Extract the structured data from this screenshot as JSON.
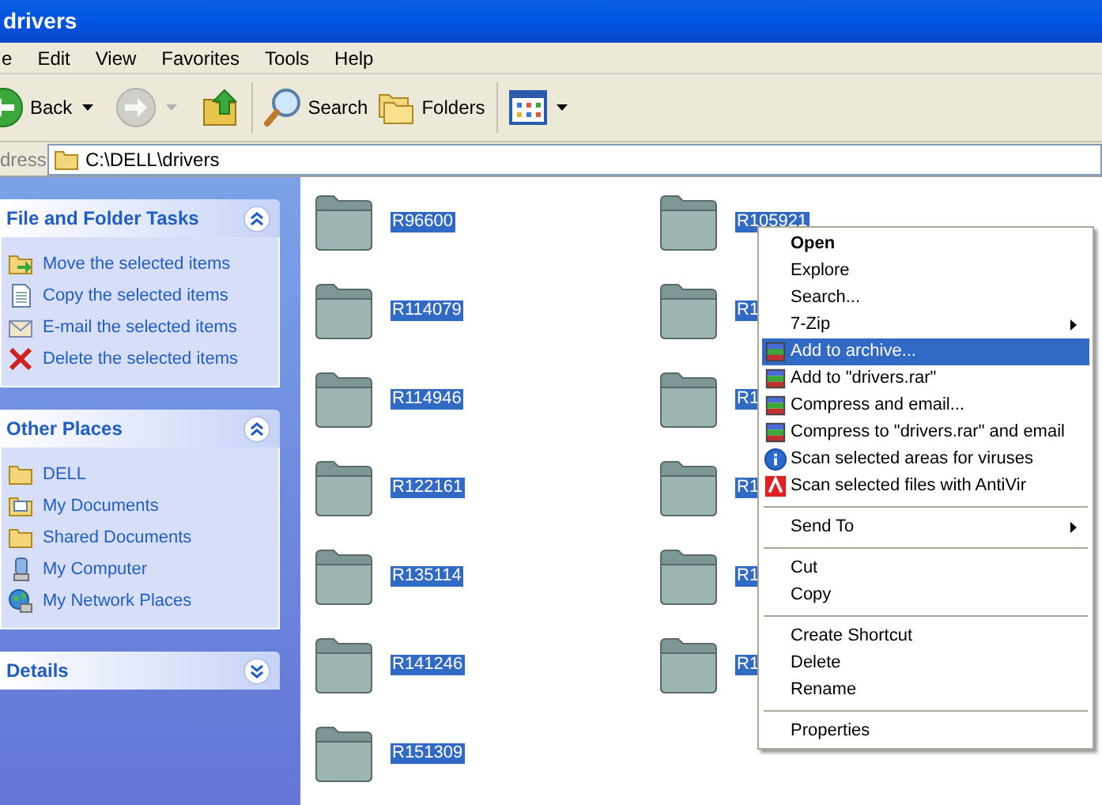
{
  "window": {
    "title": "drivers"
  },
  "menu_bar": [
    "e",
    "Edit",
    "View",
    "Favorites",
    "Tools",
    "Help"
  ],
  "toolbar": [
    {
      "kind": "back",
      "label": "Back",
      "disabled": false
    },
    {
      "kind": "forward",
      "disabled": true
    },
    {
      "kind": "up",
      "disabled": false
    },
    {
      "kind": "search",
      "label": "Search",
      "disabled": false
    },
    {
      "kind": "folders",
      "label": "Folders",
      "disabled": false
    },
    {
      "kind": "views",
      "disabled": false
    }
  ],
  "address": {
    "label": "dress",
    "value": "C:\\DELL\\drivers"
  },
  "task_panels": [
    {
      "title": "File and Folder Tasks",
      "expanded": true,
      "items": [
        {
          "kind": "move",
          "label": "Move the selected items"
        },
        {
          "kind": "copy",
          "label": "Copy the selected items"
        },
        {
          "kind": "email",
          "label": "E-mail the selected items"
        },
        {
          "kind": "delete",
          "label": "Delete the selected items"
        }
      ]
    },
    {
      "title": "Other Places",
      "expanded": true,
      "items": [
        {
          "kind": "folder",
          "label": "DELL"
        },
        {
          "kind": "documents",
          "label": "My Documents"
        },
        {
          "kind": "folder",
          "label": "Shared Documents"
        },
        {
          "kind": "computer",
          "label": "My Computer"
        },
        {
          "kind": "network",
          "label": "My Network Places"
        }
      ]
    },
    {
      "title": "Details",
      "expanded": false
    }
  ],
  "folders": [
    {
      "name": "R96600",
      "selected": true
    },
    {
      "name": "R105921",
      "selected": true
    },
    {
      "name": "R114079",
      "selected": true
    },
    {
      "name": "R1",
      "selected": true
    },
    {
      "name": "R114946",
      "selected": true
    },
    {
      "name": "R1",
      "selected": true
    },
    {
      "name": "R122161",
      "selected": true
    },
    {
      "name": "R1",
      "selected": true
    },
    {
      "name": "R135114",
      "selected": true
    },
    {
      "name": "R1",
      "selected": true
    },
    {
      "name": "R141246",
      "selected": true
    },
    {
      "name": "R1",
      "selected": true
    },
    {
      "name": "R151309",
      "selected": true
    }
  ],
  "context_menu": {
    "items": [
      {
        "kind": "item",
        "label": "Open",
        "default": true,
        "submenu": false,
        "selected": false
      },
      {
        "kind": "item",
        "label": "Explore",
        "default": false,
        "submenu": false,
        "selected": false
      },
      {
        "kind": "item",
        "label": "Search...",
        "default": false,
        "submenu": false,
        "selected": false
      },
      {
        "kind": "item",
        "label": "7-Zip",
        "default": false,
        "submenu": true,
        "selected": false
      },
      {
        "kind": "archive",
        "label": "Add to archive...",
        "default": false,
        "submenu": false,
        "selected": true
      },
      {
        "kind": "archive",
        "label": "Add to \"drivers.rar\"",
        "default": false,
        "submenu": false,
        "selected": false
      },
      {
        "kind": "archive",
        "label": "Compress and email...",
        "default": false,
        "submenu": false,
        "selected": false
      },
      {
        "kind": "archive",
        "label": "Compress to \"drivers.rar\" and email",
        "default": false,
        "submenu": false,
        "selected": false
      },
      {
        "kind": "scan",
        "label": "Scan selected areas for viruses",
        "default": false,
        "submenu": false,
        "selected": false
      },
      {
        "kind": "antivir",
        "label": "Scan selected files with AntiVir",
        "default": false,
        "submenu": false,
        "selected": false
      },
      {
        "kind": "separator"
      },
      {
        "kind": "item",
        "label": "Send To",
        "default": false,
        "submenu": true,
        "selected": false
      },
      {
        "kind": "separator"
      },
      {
        "kind": "item",
        "label": "Cut",
        "default": false,
        "submenu": false,
        "selected": false
      },
      {
        "kind": "item",
        "label": "Copy",
        "default": false,
        "submenu": false,
        "selected": false
      },
      {
        "kind": "separator"
      },
      {
        "kind": "item",
        "label": "Create Shortcut",
        "default": false,
        "submenu": false,
        "selected": false
      },
      {
        "kind": "item",
        "label": "Delete",
        "default": false,
        "submenu": false,
        "selected": false
      },
      {
        "kind": "item",
        "label": "Rename",
        "default": false,
        "submenu": false,
        "selected": false
      },
      {
        "kind": "separator"
      },
      {
        "kind": "item",
        "label": "Properties",
        "default": false,
        "submenu": false,
        "selected": false
      }
    ]
  }
}
